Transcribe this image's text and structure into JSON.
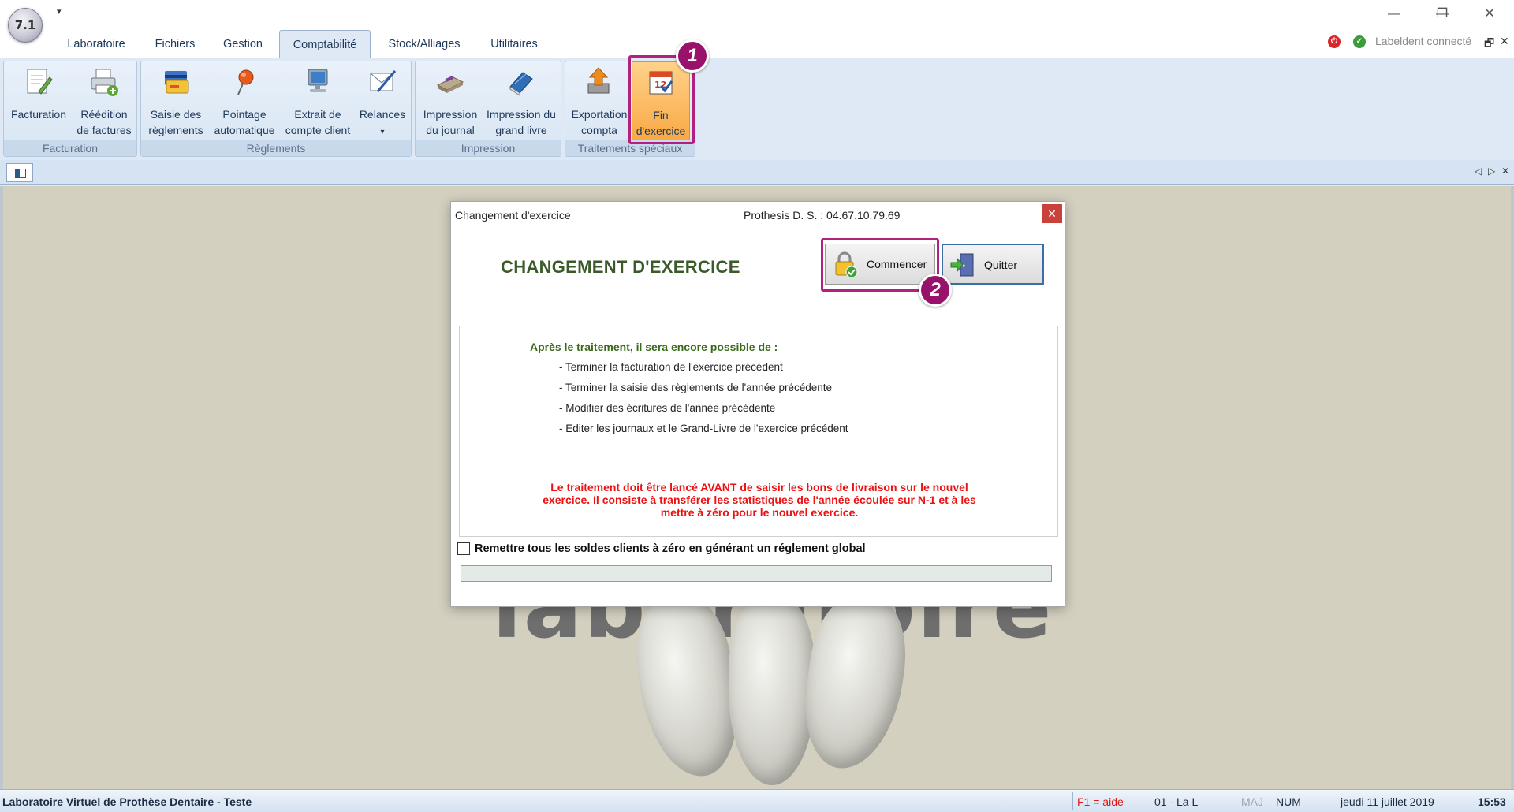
{
  "app": {
    "orb_text": "7.1",
    "qat_label": "▾"
  },
  "tabs": [
    {
      "label": "Laboratoire"
    },
    {
      "label": "Fichiers"
    },
    {
      "label": "Gestion"
    },
    {
      "label": "Comptabilité",
      "active": true
    },
    {
      "label": "Stock/Alliages"
    },
    {
      "label": "Utilitaires"
    }
  ],
  "window_controls": {
    "minimize": "—",
    "restore": "❐",
    "close": "✕"
  },
  "connection": {
    "text": "Labeldent connecté",
    "restore": "🗗",
    "close": "✕"
  },
  "ribbon": {
    "groups": [
      {
        "label": "Facturation",
        "buttons": [
          {
            "line1": "Facturation",
            "line2": "",
            "icon": "invoice-pencil-icon"
          },
          {
            "line1": "Réédition",
            "line2": "de factures",
            "icon": "printer-add-icon"
          }
        ]
      },
      {
        "label": "Règlements",
        "buttons": [
          {
            "line1": "Saisie des",
            "line2": "règlements",
            "icon": "payment-cards-icon"
          },
          {
            "line1": "Pointage",
            "line2": "automatique",
            "icon": "pin-icon"
          },
          {
            "line1": "Extrait de",
            "line2": "compte client",
            "icon": "monitor-icon"
          },
          {
            "line1": "Relances",
            "line2": "▾",
            "icon": "letter-pen-icon"
          }
        ]
      },
      {
        "label": "Impression",
        "buttons": [
          {
            "line1": "Impression",
            "line2": "du journal",
            "icon": "journal-icon"
          },
          {
            "line1": "Impression du",
            "line2": "grand livre",
            "icon": "ledger-book-icon"
          }
        ]
      },
      {
        "label": "Traitements spéciaux",
        "buttons": [
          {
            "line1": "Exportation",
            "line2": "compta",
            "icon": "export-arrow-icon"
          },
          {
            "line1": "Fin",
            "line2": "d'exercice",
            "icon": "calendar-check-icon"
          }
        ]
      }
    ]
  },
  "doc_strip": {
    "prev": "◁",
    "next": "▷",
    "close": "✕"
  },
  "background": {
    "logo_text": "laboratoire"
  },
  "dialog": {
    "title": "Changement d'exercice",
    "phone": "Prothesis D. S. : 04.67.10.79.69",
    "close": "✕",
    "heading": "CHANGEMENT D'EXERCICE",
    "start_button": "Commencer",
    "quit_button": "Quitter",
    "info_heading": "Après le traitement, il sera encore possible de :",
    "info_items": [
      "- Terminer la facturation de l'exercice précédent",
      "- Terminer la saisie des règlements de l'année précédente",
      "- Modifier des écritures de l'année précédente",
      "- Editer les journaux et le Grand-Livre de l'exercice précédent"
    ],
    "warning_lines": [
      "Le traitement doit être lancé AVANT de saisir les bons de livraison sur le nouvel",
      "exercice. Il consiste à transférer les statistiques de l'année écoulée sur N-1 et à les",
      "mettre à zéro pour le nouvel exercice."
    ],
    "checkbox_label": "Remettre tous les soldes clients à zéro en générant un réglement global",
    "checkbox_checked": false
  },
  "markers": {
    "one": "1",
    "two": "2"
  },
  "statusbar": {
    "left": "Laboratoire Virtuel de Prothèse Dentaire - Teste",
    "help": "F1 = aide",
    "lab": "01 - La L",
    "maj": "MAJ",
    "num": "NUM",
    "date": "jeudi 11 juillet 2019",
    "time": "15:53"
  },
  "colors": {
    "accent_highlight": "#b3217f",
    "marker_fill": "#98116a",
    "warning_red": "#ee1111",
    "heading_green": "#3a5a2a"
  }
}
